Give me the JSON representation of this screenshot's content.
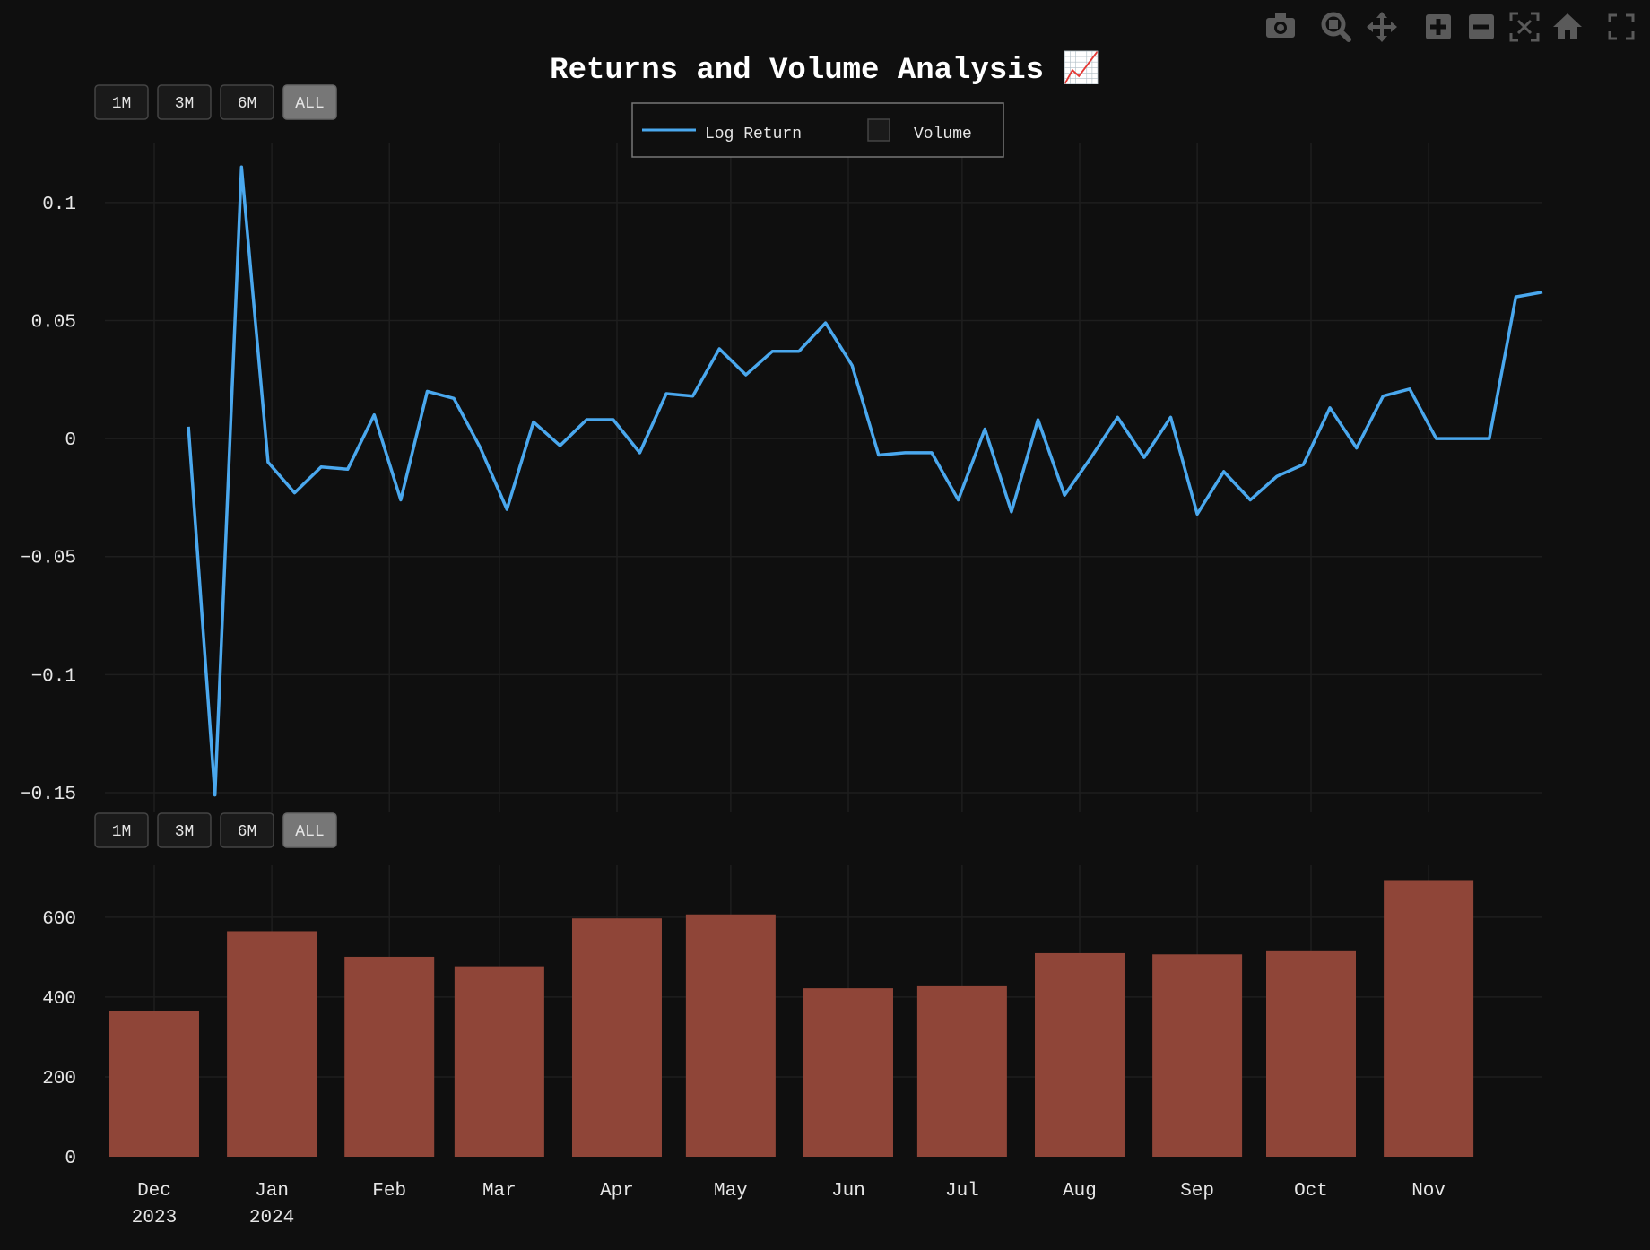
{
  "title": "Returns and Volume Analysis 📈",
  "modebar": [
    "camera-icon",
    "zoom-icon",
    "pan-icon",
    "zoom-in-icon",
    "zoom-out-icon",
    "autoscale-icon",
    "home-icon",
    "fullscreen-icon"
  ],
  "range_selector": {
    "buttons": [
      "1M",
      "3M",
      "6M",
      "ALL"
    ],
    "active": "ALL"
  },
  "colors": {
    "background": "#0f0f0f",
    "line": "#4aa8ee",
    "bar": "#8f4538",
    "grid": "#1e1e1e"
  },
  "chart_data": [
    {
      "type": "line",
      "legend_position": "top-center",
      "series": [
        {
          "name": "Log Return",
          "color": "#4aa8ee",
          "x": [
            "2023-12-10",
            "2023-12-17",
            "2023-12-24",
            "2023-12-31",
            "2024-01-07",
            "2024-01-14",
            "2024-01-21",
            "2024-01-28",
            "2024-02-04",
            "2024-02-11",
            "2024-02-18",
            "2024-02-25",
            "2024-03-03",
            "2024-03-10",
            "2024-03-17",
            "2024-03-24",
            "2024-03-31",
            "2024-04-07",
            "2024-04-14",
            "2024-04-21",
            "2024-04-28",
            "2024-05-05",
            "2024-05-12",
            "2024-05-19",
            "2024-05-26",
            "2024-06-02",
            "2024-06-09",
            "2024-06-16",
            "2024-06-23",
            "2024-06-30",
            "2024-07-07",
            "2024-07-14",
            "2024-07-21",
            "2024-07-28",
            "2024-08-04",
            "2024-08-11",
            "2024-08-18",
            "2024-08-25",
            "2024-09-01",
            "2024-09-08",
            "2024-09-15",
            "2024-09-22",
            "2024-09-29",
            "2024-10-06",
            "2024-10-13",
            "2024-10-20",
            "2024-10-27",
            "2024-11-03",
            "2024-11-10",
            "2024-11-17",
            "2024-11-24",
            "2024-12-01"
          ],
          "y": [
            0.005,
            -0.151,
            0.115,
            -0.01,
            -0.023,
            -0.012,
            -0.013,
            0.01,
            -0.026,
            0.02,
            0.017,
            -0.004,
            -0.03,
            0.007,
            -0.003,
            0.008,
            0.008,
            -0.006,
            0.019,
            0.018,
            0.038,
            0.027,
            0.037,
            0.037,
            0.049,
            0.031,
            -0.007,
            -0.006,
            -0.006,
            -0.026,
            0.004,
            -0.031,
            0.008,
            -0.024,
            -0.008,
            0.009,
            -0.008,
            0.009,
            -0.032,
            -0.014,
            -0.026,
            -0.016,
            -0.011,
            0.013,
            -0.004,
            0.018,
            0.021,
            0,
            0,
            0,
            0.06,
            0.062
          ]
        }
      ],
      "xlim": [
        "2023-11-18",
        "2024-12-01"
      ],
      "ylim": [
        -0.158,
        0.125
      ],
      "yticks": [
        0.1,
        0.05,
        0,
        -0.05,
        -0.1,
        -0.15
      ],
      "ytick_labels": [
        "0.1",
        "0.05",
        "0",
        "−0.05",
        "−0.1",
        "−0.15"
      ],
      "grid": true
    },
    {
      "type": "bar",
      "series": [
        {
          "name": "Volume",
          "color": "#8f4538",
          "x": [
            "2023-12-01",
            "2024-01-01",
            "2024-02-01",
            "2024-03-01",
            "2024-04-01",
            "2024-05-01",
            "2024-06-01",
            "2024-07-01",
            "2024-08-01",
            "2024-09-01",
            "2024-10-01",
            "2024-11-01"
          ],
          "values": [
            365,
            565,
            501,
            477,
            597,
            607,
            422,
            427,
            510,
            507,
            517,
            693
          ]
        }
      ],
      "xlim": [
        "2023-11-18",
        "2024-12-01"
      ],
      "ylim": [
        0,
        730
      ],
      "yticks": [
        0,
        200,
        400,
        600
      ],
      "ytick_labels": [
        "0",
        "200",
        "400",
        "600"
      ],
      "grid": true,
      "xticks": [
        {
          "x": "2023-12-01",
          "label": "Dec",
          "sub": "2023"
        },
        {
          "x": "2024-01-01",
          "label": "Jan",
          "sub": "2024"
        },
        {
          "x": "2024-02-01",
          "label": "Feb",
          "sub": ""
        },
        {
          "x": "2024-03-01",
          "label": "Mar",
          "sub": ""
        },
        {
          "x": "2024-04-01",
          "label": "Apr",
          "sub": ""
        },
        {
          "x": "2024-05-01",
          "label": "May",
          "sub": ""
        },
        {
          "x": "2024-06-01",
          "label": "Jun",
          "sub": ""
        },
        {
          "x": "2024-07-01",
          "label": "Jul",
          "sub": ""
        },
        {
          "x": "2024-08-01",
          "label": "Aug",
          "sub": ""
        },
        {
          "x": "2024-09-01",
          "label": "Sep",
          "sub": ""
        },
        {
          "x": "2024-10-01",
          "label": "Oct",
          "sub": ""
        },
        {
          "x": "2024-11-01",
          "label": "Nov",
          "sub": ""
        }
      ]
    }
  ]
}
